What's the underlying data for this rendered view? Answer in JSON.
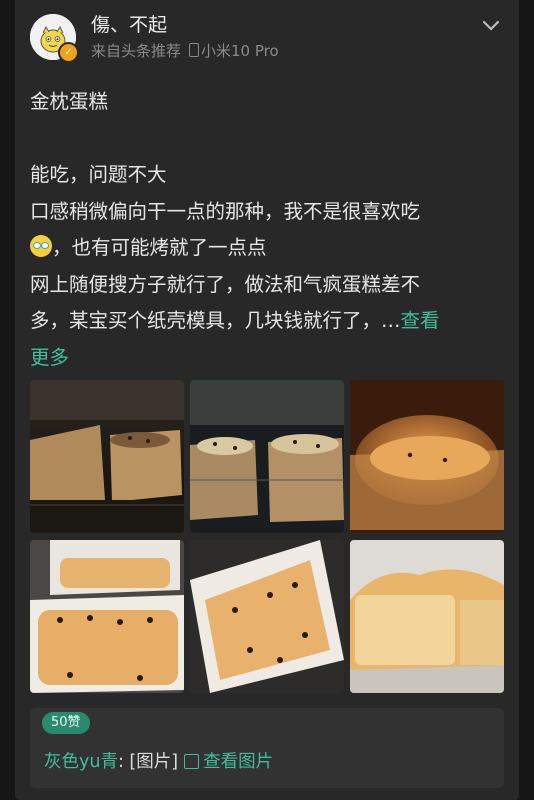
{
  "post": {
    "username": "傷、不起",
    "source": "来自头条推荐",
    "device": "小米10 Pro"
  },
  "content": {
    "title": "金枕蛋糕",
    "line1": "能吃，问题不大",
    "line2": "口感稍微偏向干一点的那种，我不是很喜欢吃",
    "line3": "，也有可能烤就了一点点",
    "line4": "网上随便搜方子就行了，做法和气疯蛋糕差不",
    "line5a": "多，某宝买个纸壳模具，几块钱就行了，…",
    "more_label_a": "查看",
    "more_label_b": "更多"
  },
  "photos": [
    {
      "name": "cake-photo-oven-1"
    },
    {
      "name": "cake-photo-oven-2"
    },
    {
      "name": "cake-photo-oven-3"
    },
    {
      "name": "cake-photo-cooled-1"
    },
    {
      "name": "cake-photo-cooled-2"
    },
    {
      "name": "cake-photo-cross-section"
    }
  ],
  "likes": {
    "count_label": "50赞"
  },
  "comment": {
    "author": "灰色yu青",
    "text": ": [图片]",
    "view_label": "查看图片"
  },
  "colors": {
    "accent": "#3fbf9a",
    "card": "#282828",
    "background": "#161616"
  }
}
